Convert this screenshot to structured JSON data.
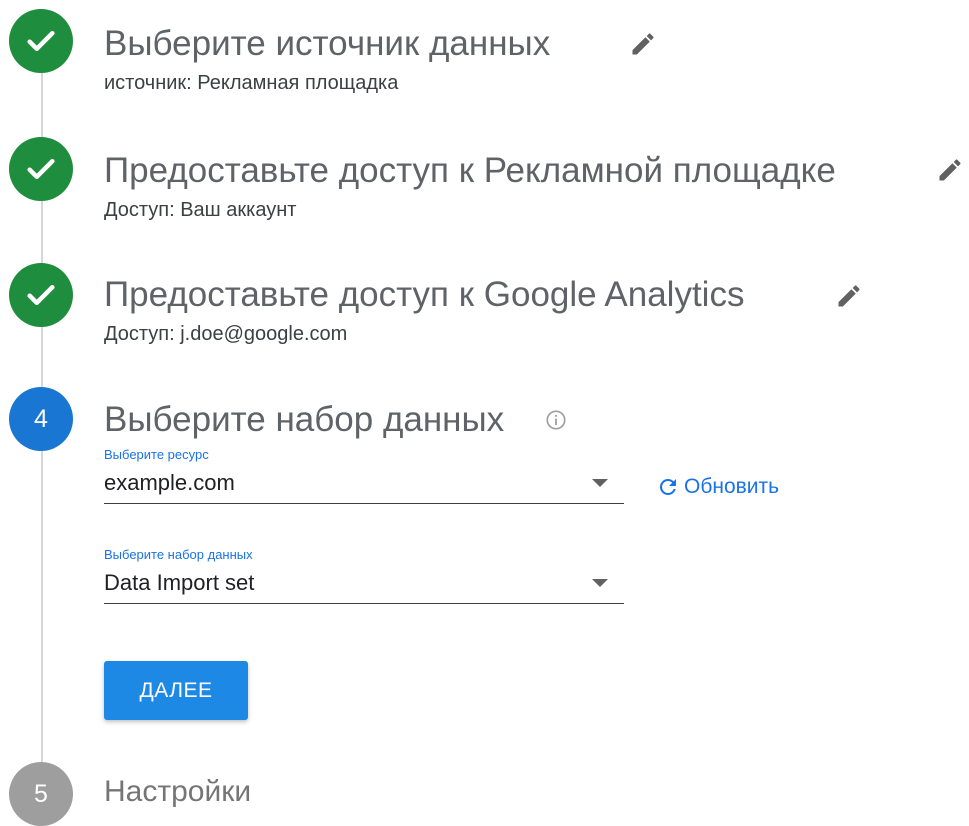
{
  "steps": [
    {
      "status": "done",
      "title": "Выберите источник данных",
      "subtitle": "источник: Рекламная площадка"
    },
    {
      "status": "done",
      "title": "Предоставьте доступ к Рекламной площадке",
      "subtitle": "Доступ: Ваш аккаунт"
    },
    {
      "status": "done",
      "title": "Предоставьте доступ к Google Analytics",
      "subtitle": "Доступ: j.doe@google.com"
    },
    {
      "status": "active",
      "number": "4",
      "title": "Выберите набор данных",
      "resource_field": {
        "label": "Выберите ресурс",
        "value": "example.com"
      },
      "refresh_label": "Обновить",
      "dataset_field": {
        "label": "Выберите набор данных",
        "value": "Data Import set"
      },
      "next_label": "ДАЛЕЕ"
    },
    {
      "status": "pending",
      "number": "5",
      "title": "Настройки"
    }
  ],
  "icons": {
    "done": "check-icon",
    "edit": "pencil-icon",
    "info": "info-icon",
    "refresh": "refresh-icon",
    "dropdown": "caret-down-icon"
  },
  "colors": {
    "done": "#1e8e3e",
    "active": "#1976d2",
    "pending": "#9e9e9e",
    "accent": "#1a73e8",
    "button": "#1e88e5"
  }
}
